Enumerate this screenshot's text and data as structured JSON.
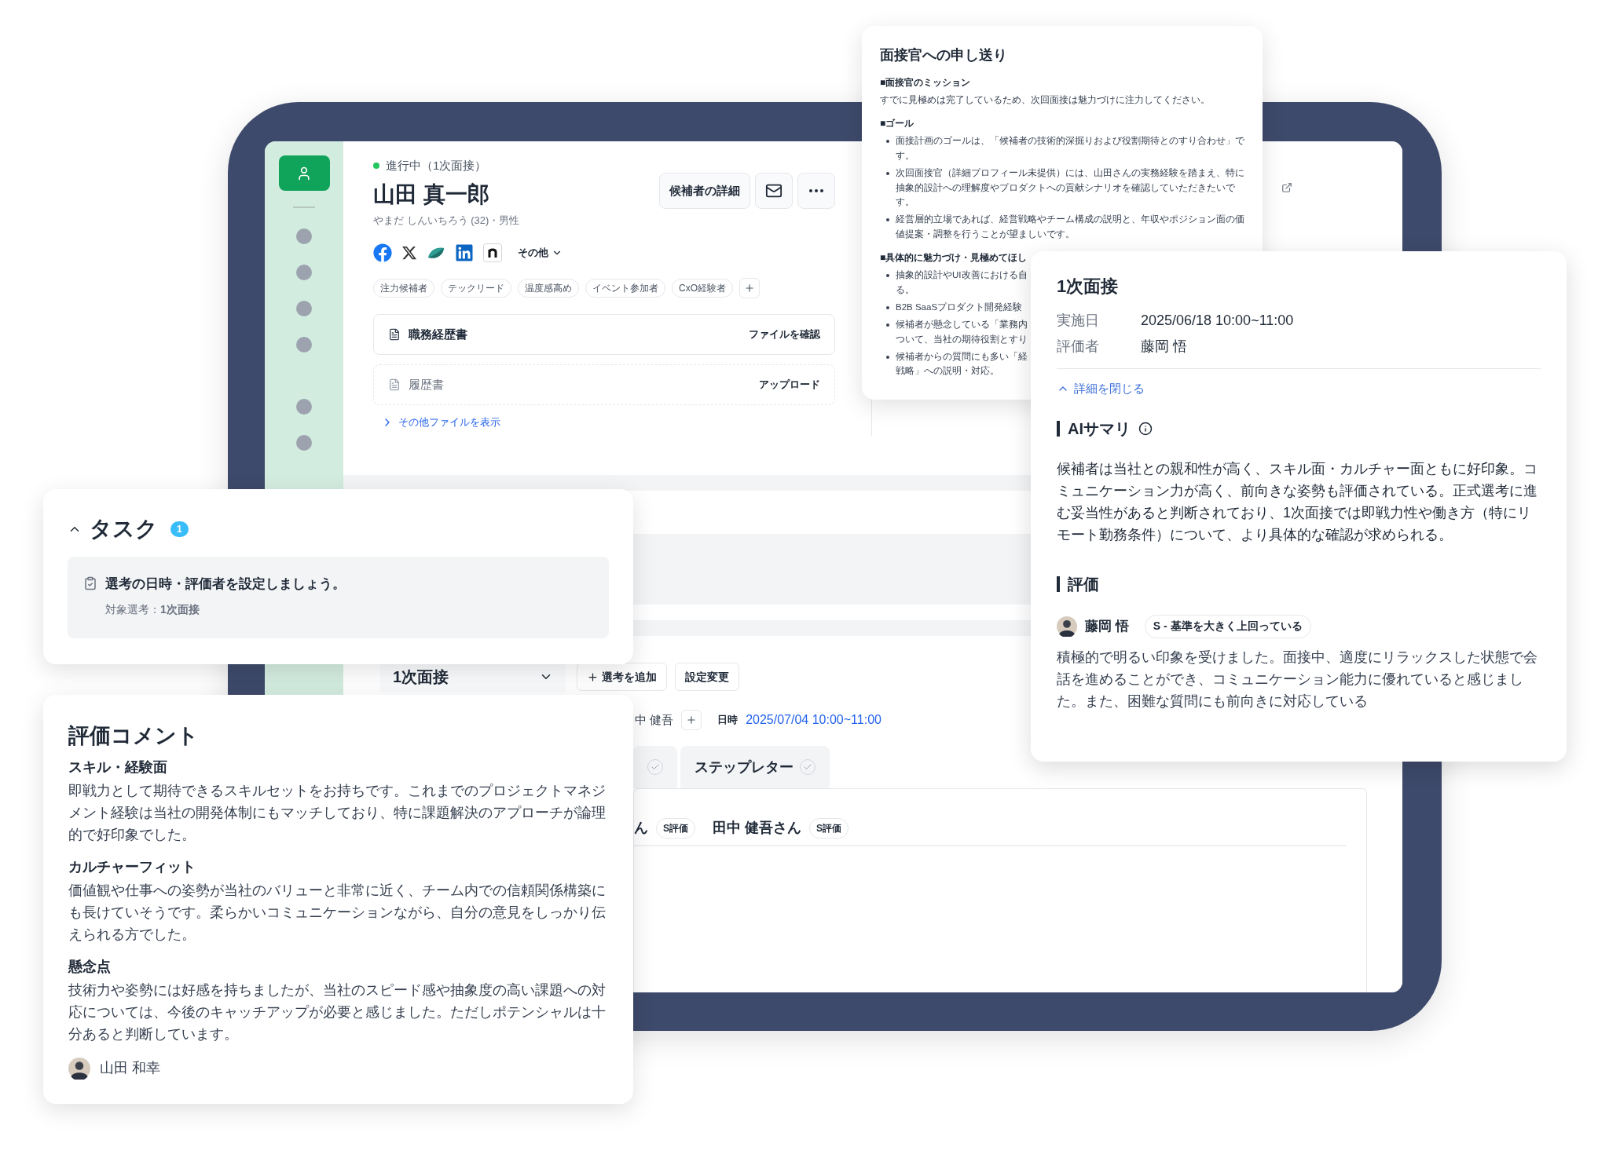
{
  "tablet": {
    "sidebar": [
      {
        "selected": true
      },
      {
        "selected": false
      },
      {
        "selected": false
      },
      {
        "selected": false
      },
      {
        "selected": false
      },
      {
        "selected": false
      },
      {
        "selected": false
      }
    ],
    "status": "進行中（1次面接）",
    "name": "山田 真一郎",
    "reading": "やまだ しんいちろう (32)・男性",
    "header_buttons": [
      {
        "kind": "text",
        "label": "候補者の詳細"
      },
      {
        "kind": "mail"
      },
      {
        "kind": "more"
      }
    ],
    "social_links": [
      {
        "kind": "facebook"
      },
      {
        "kind": "x"
      },
      {
        "kind": "wave"
      },
      {
        "kind": "linkedin"
      },
      {
        "kind": "n"
      }
    ],
    "other_links": "その他",
    "tags": [
      "注力候補者",
      "テックリード",
      "温度感高め",
      "イベント参加者",
      "CxO経験者"
    ],
    "files": [
      {
        "name": "職務経歴書",
        "action": "ファイルを確認",
        "uploaded": true
      },
      {
        "name": "履歴書",
        "action": "アップロード",
        "uploaded": false
      }
    ],
    "more_files": "その他ファイルを表示",
    "stage_select": "1次面接",
    "stage_buttons": [
      {
        "kind": "add",
        "label": "選考を追加"
      },
      {
        "kind": "plain",
        "label": "設定変更"
      }
    ],
    "evaluator": "中 健吾",
    "schedule_label": "日時",
    "schedule_value": "2025/07/04 10:00~11:00",
    "tabs": [
      {
        "selected": false,
        "done": true
      },
      {
        "label": "ステップレター",
        "selected": false,
        "done": true
      }
    ],
    "evaluations": [
      {
        "name": "ん",
        "grade": "S評価"
      },
      {
        "name": "田中 健吾さん",
        "grade": "S評価"
      }
    ]
  },
  "handover": {
    "title": "面接官への申し送り",
    "sections": [
      {
        "heading": "■面接官のミッション",
        "kind": "paragraph",
        "text": "すでに見極めは完了しているため、次回面接は魅力づけに注力してください。"
      },
      {
        "heading": "■ゴール",
        "kind": "bullets",
        "items": [
          {
            "kind": "full",
            "text": "面接計画のゴールは、「候補者の技術的深掘りおよび役割期待とのすり合わせ」です。"
          },
          {
            "kind": "full",
            "text": "次回面接官（詳細プロフィール未提供）には、山田さんの実務経験を踏まえ、特に抽象的設計への理解度やプロダクトへの貢献シナリオを確認していただきたいです。"
          },
          {
            "kind": "full",
            "text": "経営層的立場であれば、経営戦略やチーム構成の説明と、年収やポジション面の価値提案・調整を行うことが望ましいです。"
          }
        ]
      },
      {
        "heading": "■具体的に魅力づけ・見極めてほし",
        "kind": "bullets",
        "items": [
          {
            "kind": "cut",
            "lines": [
              "抽象的設計やUI改善における自",
              "る。"
            ]
          },
          {
            "kind": "cut",
            "lines": [
              "B2B SaaSプロダクト開発経験"
            ]
          },
          {
            "kind": "cut",
            "lines": [
              "候補者が懸念している「業務内",
              "ついて、当社の期待役割とすり"
            ]
          },
          {
            "kind": "cut",
            "lines": [
              "候補者からの質問にも多い「経",
              "戦略」への説明・対応。"
            ]
          }
        ]
      }
    ]
  },
  "interview": {
    "title": "1次面接",
    "fields": [
      {
        "label": "実施日",
        "value": "2025/06/18 10:00~11:00"
      },
      {
        "label": "評価者",
        "value": "藤岡 悟"
      }
    ],
    "collapse": "詳細を閉じる",
    "expanded": true,
    "ai_title": "AIサマリ",
    "ai_text": "候補者は当社との親和性が高く、スキル面・カルチャー面ともに好印象。コミュニケーション力が高く、前向きな姿勢も評価されている。正式選考に進む妥当性があると判断されており、1次面接では即戦力性や働き方（特にリモート勤務条件）について、より具体的な確認が求められる。",
    "eval_title": "評価",
    "evaluator": "藤岡 悟",
    "grade": "S - 基準を大きく上回っている",
    "comment": "積極的で明るい印象を受けました。面接中、適度にリラックスした状態で会話を進めることができ、コミュニケーション能力に優れていると感じました。また、困難な質問にも前向きに対応している"
  },
  "tasks": {
    "title": "タスク",
    "count": "1",
    "expanded": true,
    "items": [
      {
        "title": "選考の日時・評価者を設定しましょう。",
        "target": "対象選考：**1次面接**"
      }
    ]
  },
  "comments": {
    "title": "評価コメント",
    "sections": [
      {
        "heading": "スキル・経験面",
        "text": "即戦力として期待できるスキルセットをお持ちです。これまでのプロジェクトマネジメント経験は当社の開発体制にもマッチしており、特に課題解決のアプローチが論理的で好印象でした。"
      },
      {
        "heading": "カルチャーフィット",
        "text": "価値観や仕事への姿勢が当社のバリューと非常に近く、チーム内での信頼関係構築にも長けていそうです。柔らかいコミュニケーションながら、自分の意見をしっかり伝えられる方でした。"
      },
      {
        "heading": "懸念点",
        "text": "技術力や姿勢には好感を持ちましたが、当社のスピード感や抽象度の高い課題への対応については、今後のキャッチアップが必要と感じました。ただしポテンシャルは十分あると判断しています。"
      }
    ],
    "author": "山田 和幸"
  }
}
